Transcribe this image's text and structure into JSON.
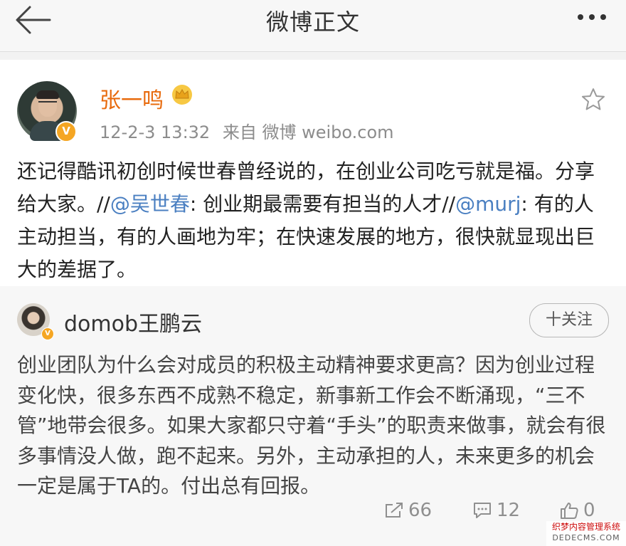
{
  "nav": {
    "title": "微博正文",
    "back_icon": "back-arrow-icon",
    "more_icon": "more-dots-icon"
  },
  "post": {
    "author": "张一鸣",
    "author_badge_icon": "crown-icon",
    "verified_icon": "verified-v-icon",
    "timestamp": "12-2-3 13:32",
    "source": "来自 微博 weibo.com",
    "favorite_icon": "star-outline-icon",
    "text_part1": "还记得酷讯初创时候世春曾经说的，在创业公司吃亏就是福。分享给大家。//",
    "mention1": "@吴世春",
    "text_part2": ": 创业期最需要有担当的人才//",
    "mention2": "@murj",
    "text_part3": ": 有的人主动担当，有的人画地为牢；在快速发展的地方，很快就显现出巨大的差据了。"
  },
  "repost": {
    "author": "domob王鹏云",
    "follow_label": "十关注",
    "text": "创业团队为什么会对成员的积极主动精神要求更高？因为创业过程变化快，很多东西不成熟不稳定，新事新工作会不断涌现，“三不管”地带会很多。如果大家都只守着“手头”的职责来做事，就会有很多事情没人做，跑不起来。另外，主动承担的人，未来更多的机会一定是属于TA的。付出总有回报。",
    "repost_count": "66",
    "comment_count": "12",
    "like_count": "0",
    "repost_icon": "repost-icon",
    "comment_icon": "comment-icon",
    "like_icon": "thumbs-up-icon"
  },
  "watermark": {
    "line1": "织梦内容管理系统",
    "line2": "DEDECMS.COM"
  },
  "colors": {
    "author_name": "#e86b0e",
    "mention": "#4a7fc1",
    "verified": "#f5a623"
  }
}
